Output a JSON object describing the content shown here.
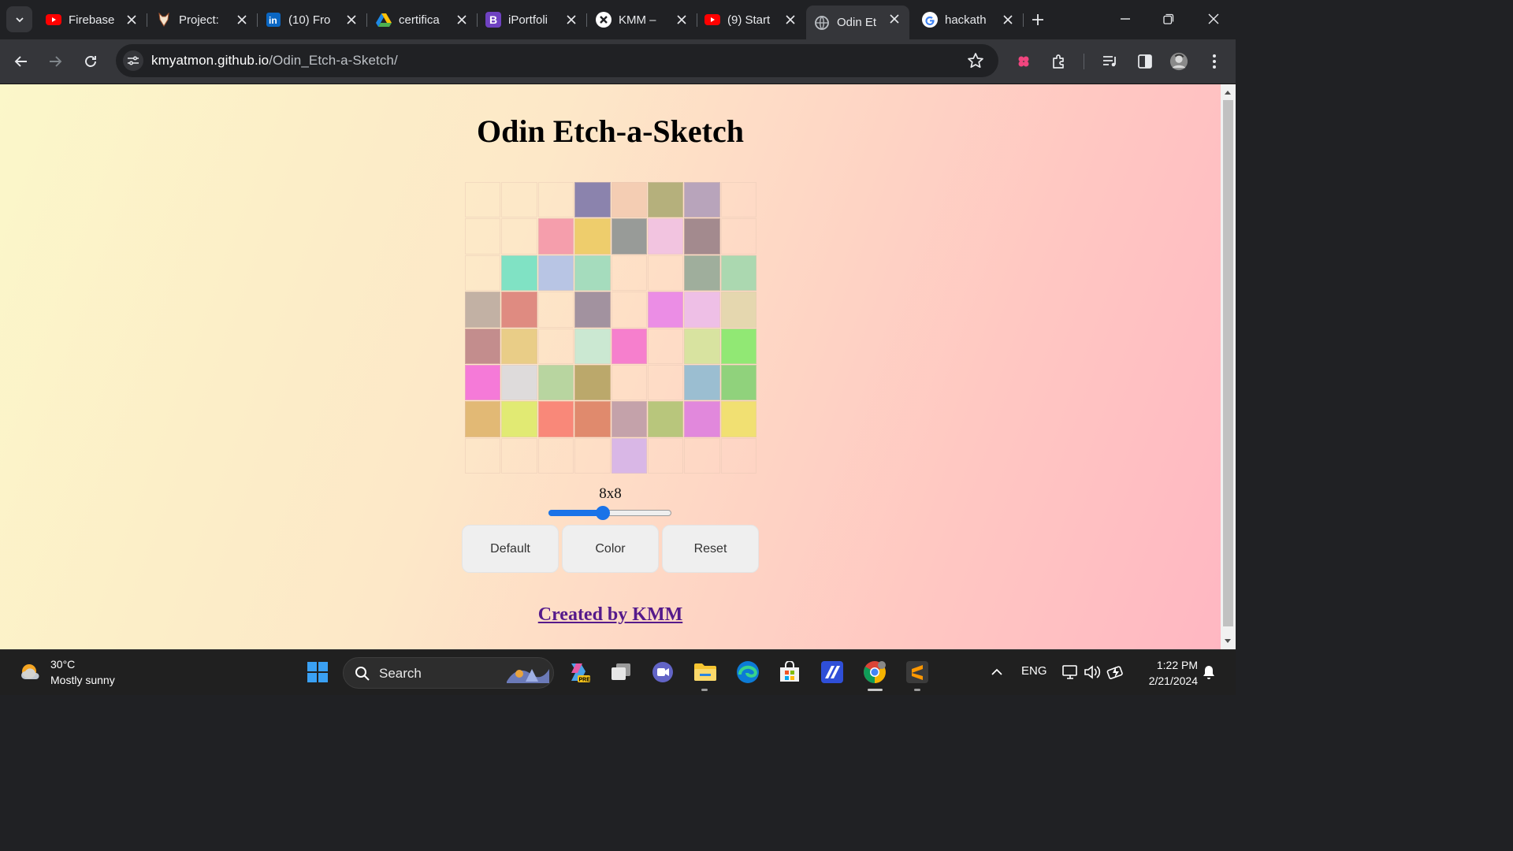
{
  "browser": {
    "tabs": [
      {
        "title": "Firebase",
        "icon": "youtube-icon"
      },
      {
        "title": "Project:",
        "icon": "project-favicon-icon"
      },
      {
        "title": "(10) Fro",
        "icon": "linkedin-icon"
      },
      {
        "title": "certifica",
        "icon": "google-drive-icon"
      },
      {
        "title": "iPortfoli",
        "icon": "bootstrap-icon"
      },
      {
        "title": "KMM –",
        "icon": "site-favicon-icon"
      },
      {
        "title": "(9) Start",
        "icon": "youtube-icon"
      },
      {
        "title": "Odin Et",
        "icon": "globe-icon",
        "active": true
      },
      {
        "title": "hackath",
        "icon": "google-icon"
      }
    ],
    "url_host": "kmyatmon.github.io",
    "url_path": "/Odin_Etch-a-Sketch/"
  },
  "app": {
    "title": "Odin Etch-a-Sketch",
    "grid_label": "8x8",
    "grid_size": 8,
    "slider": {
      "min": 1,
      "max": 16,
      "value": 8,
      "percent": 44
    },
    "buttons": {
      "default": "Default",
      "color": "Color",
      "reset": "Reset"
    },
    "credit": "Created by KMM",
    "cells": [
      [
        "",
        "",
        "",
        "#8b83ad",
        "#f4cdb3",
        "#b5b07c",
        "#b8a4bb",
        ""
      ],
      [
        "",
        "",
        "#f59eac",
        "#eecd6c",
        "#989b98",
        "#f2c4e0",
        "#a38a8e",
        ""
      ],
      [
        "",
        "#80e2c4",
        "#b8c5e4",
        "#a5dcbd",
        "",
        "",
        "#9fae9c",
        "#abd8b0"
      ],
      [
        "#c2b1a4",
        "#df8b81",
        "",
        "#a2929f",
        "",
        "#eb8de5",
        "#eebfe6",
        "#e5d7af"
      ],
      [
        "#c38d8d",
        "#e9cd87",
        "",
        "#cbe8d2",
        "#f67fcd",
        "",
        "#d8e3a0",
        "#91e874"
      ],
      [
        "#f57ad8",
        "#dedbdb",
        "#b8d5a0",
        "#bba86b",
        "",
        "",
        "#9bbed1",
        "#90d27c"
      ],
      [
        "#e2b975",
        "#e1ea73",
        "#f98879",
        "#e08a6d",
        "#c4a2aa",
        "#b8c67c",
        "#e188dc",
        "#f1e072"
      ],
      [
        "",
        "",
        "",
        "",
        "#d9b7e6",
        "",
        "",
        ""
      ]
    ]
  },
  "taskbar": {
    "temperature": "30°C",
    "condition": "Mostly sunny",
    "search_label": "Search",
    "language": "ENG",
    "time": "1:22 PM",
    "date": "2/21/2024"
  }
}
